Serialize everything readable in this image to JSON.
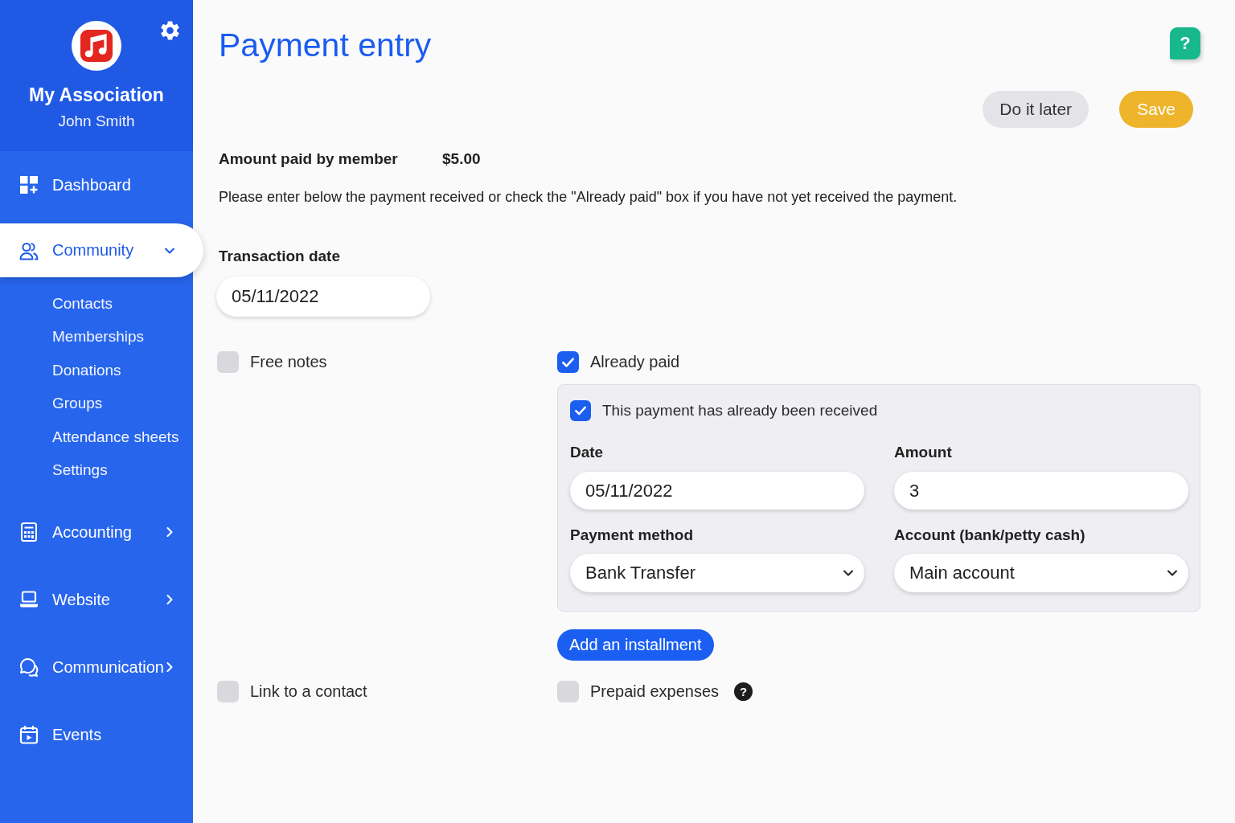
{
  "sidebar": {
    "organization": "My Association",
    "user": "John Smith",
    "nav": [
      {
        "label": "Dashboard",
        "kind": "link",
        "selected": false
      },
      {
        "label": "Community",
        "kind": "group",
        "selected": true,
        "expanded": true,
        "children": [
          {
            "label": "Contacts",
            "selected": false
          },
          {
            "label": "Memberships",
            "selected": false
          },
          {
            "label": "Donations",
            "selected": false
          },
          {
            "label": "Groups",
            "selected": false
          },
          {
            "label": "Attendance sheets",
            "selected": false
          },
          {
            "label": "Settings",
            "selected": false
          }
        ]
      },
      {
        "label": "Accounting",
        "kind": "group",
        "selected": false,
        "expanded": false
      },
      {
        "label": "Website",
        "kind": "group",
        "selected": false,
        "expanded": false
      },
      {
        "label": "Communication",
        "kind": "group",
        "selected": false,
        "expanded": false
      },
      {
        "label": "Events",
        "kind": "link",
        "selected": false
      }
    ]
  },
  "header": {
    "title": "Payment entry",
    "help_button": "?"
  },
  "actions": [
    {
      "label": "Do it later",
      "kind": "secondary"
    },
    {
      "label": "Save",
      "kind": "primary"
    }
  ],
  "summary": {
    "label": "Amount paid by member",
    "value": "$5.00"
  },
  "instructions": "Please enter below the payment received or check the \"Already paid\" box if you have not yet received the payment.",
  "transaction_date": {
    "label": "Transaction date",
    "value": "05/11/2022"
  },
  "free_notes": {
    "label": "Free notes",
    "checked": false
  },
  "already_paid": {
    "label": "Already paid",
    "checked": true,
    "panel": {
      "received": {
        "label": "This payment has already been received",
        "checked": true
      },
      "fields": [
        {
          "label": "Date",
          "kind": "text",
          "value": "05/11/2022"
        },
        {
          "label": "Amount",
          "kind": "text",
          "value": "3"
        },
        {
          "label": "Payment method",
          "kind": "select",
          "value": "Bank Transfer"
        },
        {
          "label": "Account (bank/petty cash)",
          "kind": "select",
          "value": "Main account"
        }
      ]
    },
    "add_button": "Add an installment"
  },
  "link_contact": {
    "label": "Link to a contact",
    "checked": false
  },
  "prepaid_expenses": {
    "label": "Prepaid expenses",
    "checked": false,
    "help_button": "?"
  }
}
